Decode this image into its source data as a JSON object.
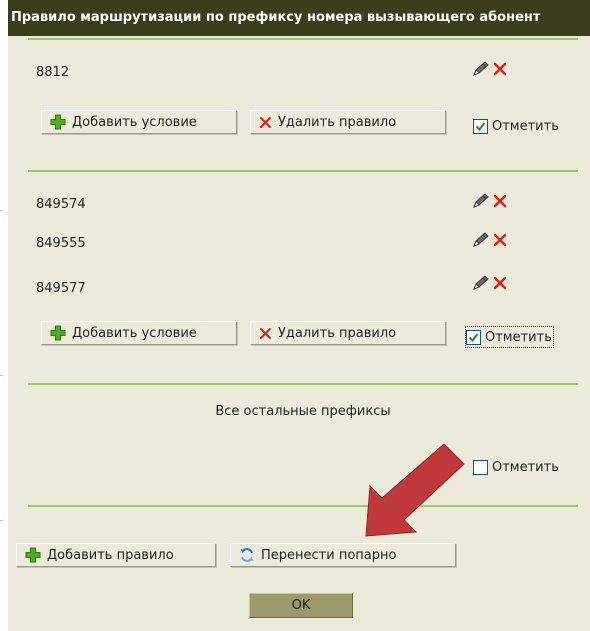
{
  "dialog": {
    "title": "Правило маршрутизации по префиксу номера вызывающего абонент"
  },
  "rules": [
    {
      "prefixes": [
        "8812"
      ],
      "add_condition_label": "Добавить условие",
      "delete_rule_label": "Удалить правило",
      "mark_label": "Отметить",
      "mark_checked": true
    },
    {
      "prefixes": [
        "849574",
        "849555",
        "849577"
      ],
      "add_condition_label": "Добавить условие",
      "delete_rule_label": "Удалить правило",
      "mark_label": "Отметить",
      "mark_checked": true
    }
  ],
  "default_rule": {
    "label": "Все остальные префиксы",
    "mark_label": "Отметить",
    "mark_checked": false
  },
  "footer": {
    "add_rule_label": "Добавить правило",
    "move_pairwise_label": "Перенести попарно",
    "ok_label": "OK"
  },
  "colors": {
    "title_bg": "#3c3d1a",
    "panel_bg": "#ecebdb",
    "separator": "#9bc76a",
    "plus_icon": "#4caf1e",
    "delete_icon": "#e02010",
    "ok_button": "#9c9a6a",
    "arrow": "#c0393a"
  },
  "icons": [
    "edit-pencil-icon",
    "delete-x-icon",
    "plus-icon",
    "refresh-icon",
    "checkmark-icon"
  ]
}
